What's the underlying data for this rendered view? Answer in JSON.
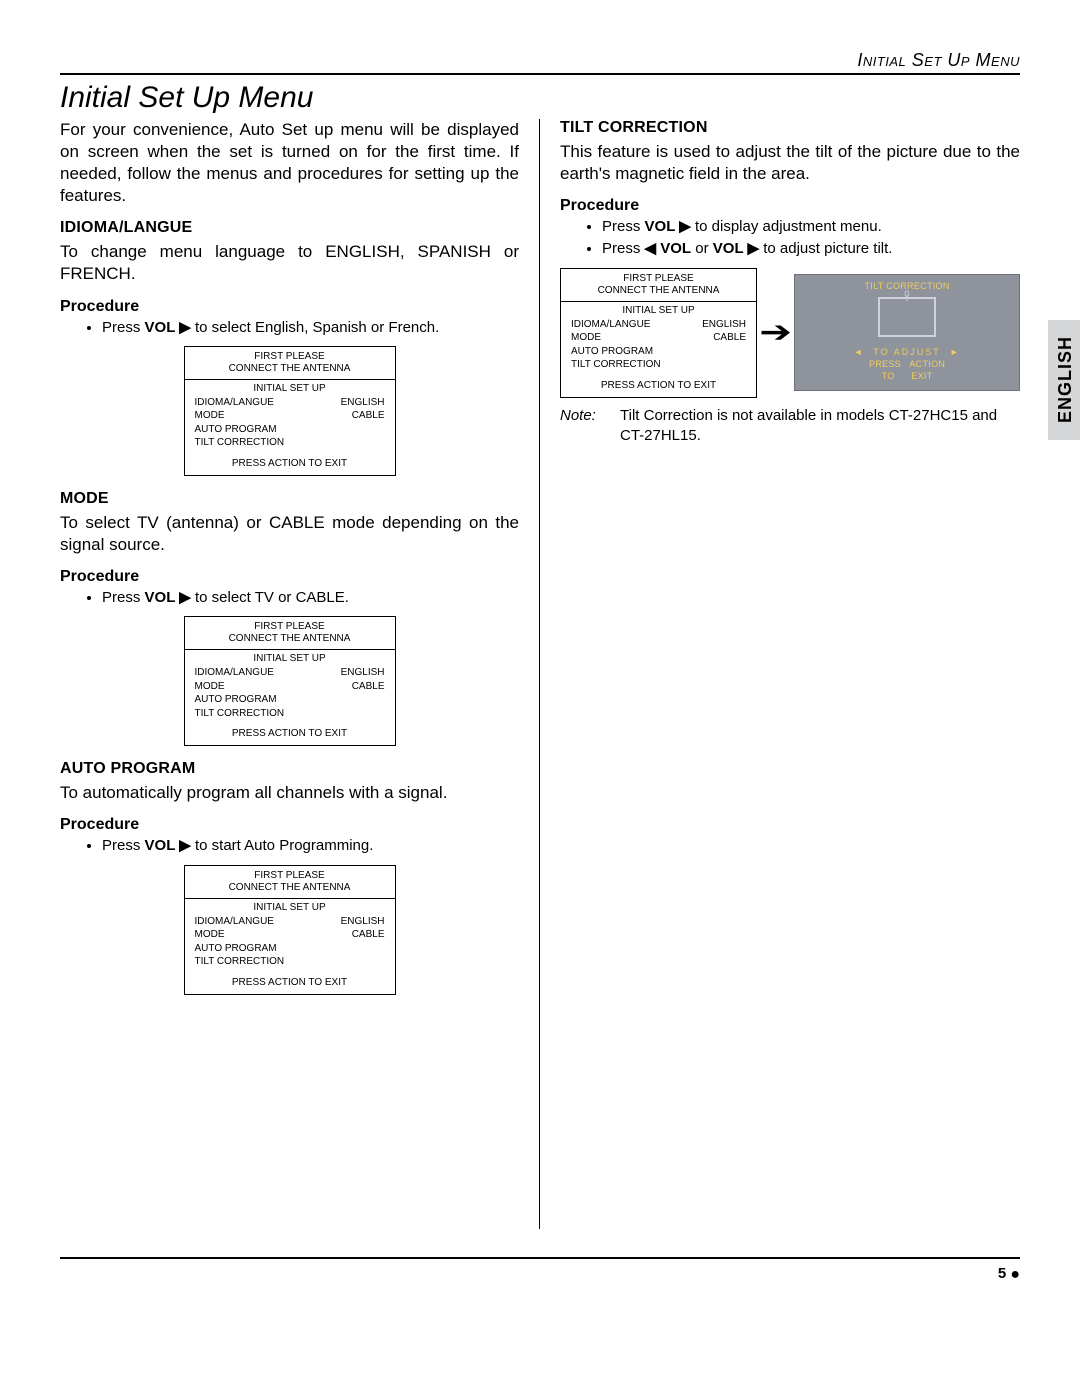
{
  "header": {
    "running_head": "Initial Set Up Menu",
    "title": "Initial Set Up Menu"
  },
  "side_tab": "ENGLISH",
  "intro": "For your convenience, Auto Set up menu will be displayed on screen when the set is turned on for the first time. If needed, follow the menus and procedures for setting up the features.",
  "sections": {
    "idioma": {
      "heading": "IDIOMA/LANGUE",
      "body": "To change menu language to ENGLISH, SPANISH or FRENCH.",
      "proc_label": "Procedure",
      "bullet_pre": "Press ",
      "bullet_vol": "VOL",
      "bullet_post": " to select English, Spanish or French."
    },
    "mode": {
      "heading": "MODE",
      "body": "To select TV (antenna) or CABLE mode depending on the signal source.",
      "proc_label": "Procedure",
      "bullet_pre": "Press ",
      "bullet_vol": "VOL",
      "bullet_post": " to select TV or CABLE."
    },
    "auto": {
      "heading": "AUTO PROGRAM",
      "body": "To automatically program all channels with a signal.",
      "proc_label": "Procedure",
      "bullet_pre": "Press ",
      "bullet_vol": "VOL",
      "bullet_post": " to start Auto Programming."
    },
    "tilt": {
      "heading": "TILT CORRECTION",
      "body": "This feature is used to adjust the tilt of the picture due to the earth's magnetic field in the area.",
      "proc_label": "Procedure",
      "bullets": {
        "b1_pre": "Press ",
        "b1_vol": "VOL",
        "b1_post": " to display adjustment menu.",
        "b2_pre": "Press ",
        "b2_vol1": "VOL",
        "b2_mid": " or ",
        "b2_vol2": "VOL",
        "b2_post": " to adjust picture tilt."
      },
      "note_label": "Note:",
      "note_text": "Tilt Correction is not available in models CT-27HC15 and CT-27HL15."
    }
  },
  "tvmenu": {
    "top1": "FIRST PLEASE",
    "top2": "CONNECT THE ANTENNA",
    "subtitle": "INITIAL SET UP",
    "rows": [
      {
        "l": "IDIOMA/LANGUE",
        "r": "ENGLISH"
      },
      {
        "l": "MODE",
        "r": "CABLE"
      },
      {
        "l": "AUTO PROGRAM",
        "r": ""
      },
      {
        "l": "TILT CORRECTION",
        "r": ""
      }
    ],
    "footer": "PRESS ACTION TO EXIT"
  },
  "tilt_screen": {
    "title": "TILT CORRECTION",
    "value": "0",
    "line1_l": "◄",
    "line1_c": "TO ADJUST",
    "line1_r": "►",
    "line2a": "PRESS",
    "line2b": "ACTION",
    "line3a": "TO",
    "line3b": "EXIT"
  },
  "glyphs": {
    "right": "▶",
    "left": "◀",
    "big_right": "➔"
  },
  "footer": {
    "page": "5",
    "dot": "●"
  }
}
